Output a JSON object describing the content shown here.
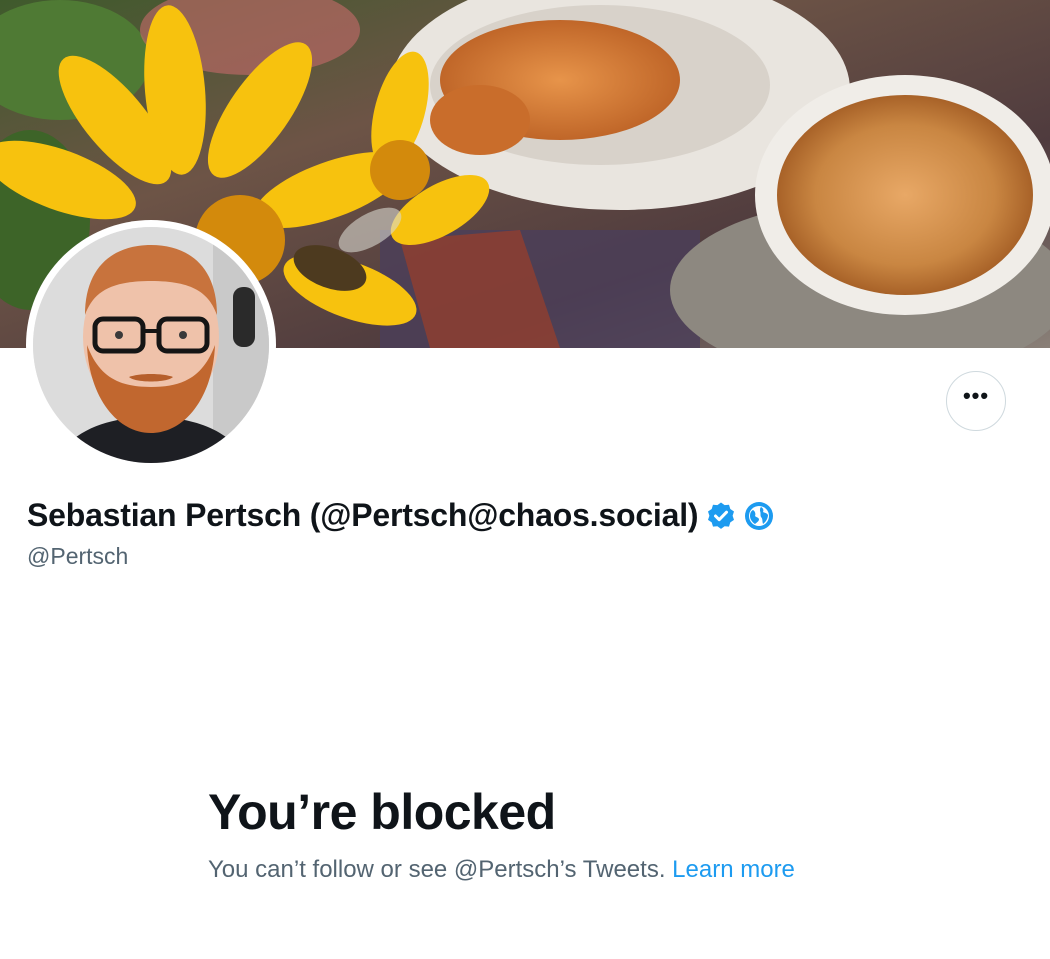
{
  "profile": {
    "display_name": "Sebastian Pertsch (@Pertsch@chaos.social)",
    "handle": "@Pertsch",
    "verified_icon": "verified-badge-icon",
    "affiliation_icon": "globe-icon"
  },
  "actions": {
    "more_label": "•••"
  },
  "blocked": {
    "title": "You’re blocked",
    "message": "You can’t follow or see @Pertsch’s Tweets.",
    "link": "Learn more"
  },
  "colors": {
    "accent": "#1d9bf0",
    "text_primary": "#0f1419",
    "text_secondary": "#536471",
    "border": "#cfd9de"
  }
}
